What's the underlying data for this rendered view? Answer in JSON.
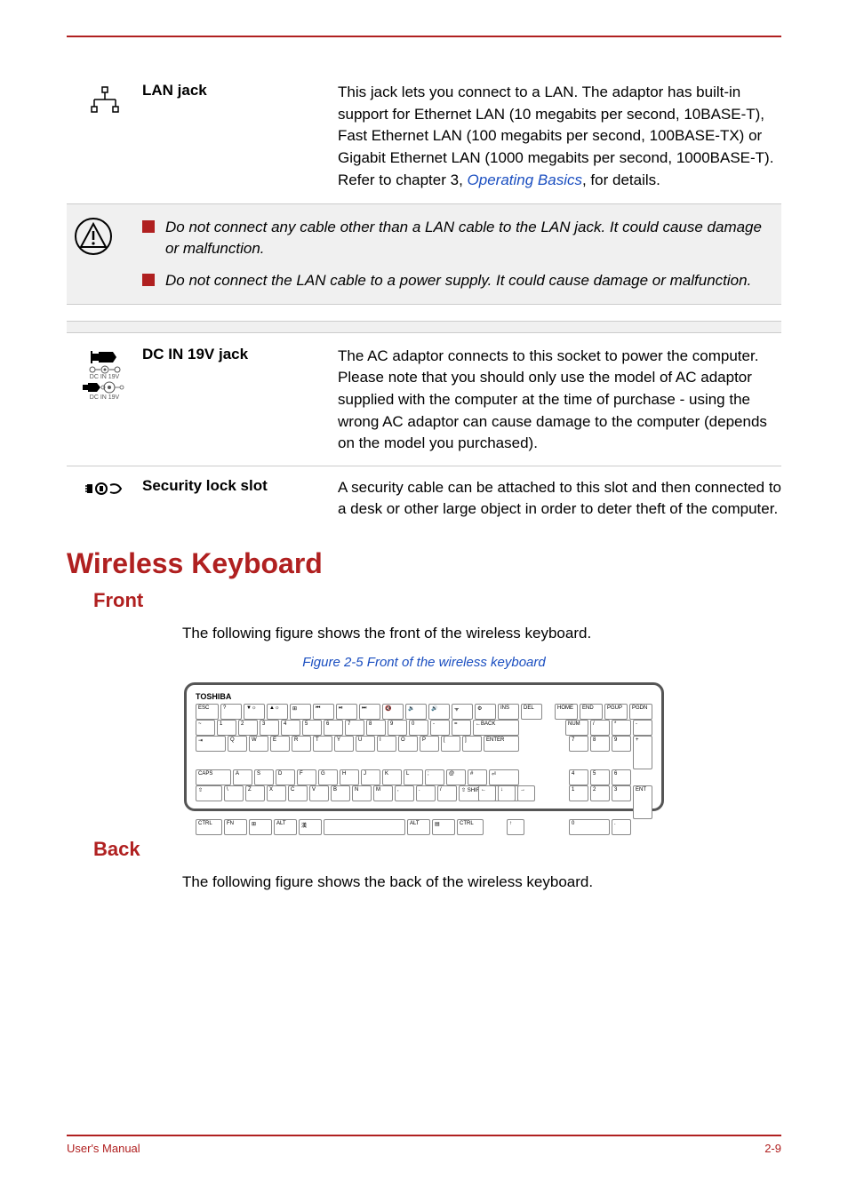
{
  "ports": {
    "lan": {
      "label": "LAN jack",
      "desc_part1": "This jack lets you connect to a LAN. The adaptor has built-in support for Ethernet LAN (10 megabits per second, 10BASE-T), Fast Ethernet LAN (100 megabits per second, 100BASE-TX) or Gigabit Ethernet LAN (1000 megabits per second, 1000BASE-T). Refer to chapter 3, ",
      "link": "Operating Basics",
      "desc_part2": ", for details."
    },
    "dc": {
      "label": "DC IN 19V jack",
      "desc": "The AC adaptor connects to this socket to power the computer. Please note that you should only use the model of AC adaptor supplied with the computer at the time of purchase - using the wrong AC adaptor can cause damage to the computer (depends on the model you purchased)."
    },
    "lock": {
      "label": "Security lock slot",
      "desc": "A security cable can be attached to this slot and then connected to a desk or other large object in order to deter theft of the computer."
    }
  },
  "warnings": {
    "item1": "Do not connect any cable other than a LAN cable to the LAN jack. It could cause damage or malfunction.",
    "item2": "Do not connect the LAN cable to a power supply. It could cause damage or malfunction."
  },
  "section": {
    "title": "Wireless Keyboard",
    "front": {
      "heading": "Front",
      "text": "The following figure shows the front of the wireless keyboard.",
      "caption": "Figure 2-5 Front of the wireless keyboard"
    },
    "back": {
      "heading": "Back",
      "text": "The following figure shows the back of the wireless keyboard."
    }
  },
  "keyboard": {
    "brand": "TOSHIBA"
  },
  "footer": {
    "left": "User's Manual",
    "right": "2-9"
  },
  "icon_labels": {
    "dc_top": "DC IN 19V",
    "dc_bottom": "DC IN 19V"
  }
}
